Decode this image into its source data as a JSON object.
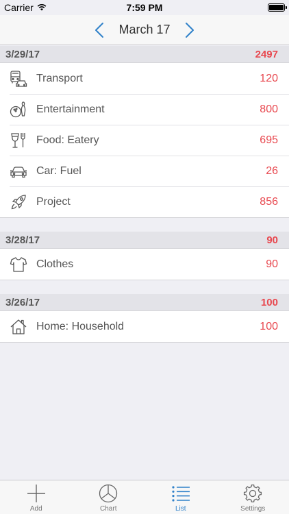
{
  "status_bar": {
    "carrier": "Carrier",
    "time": "7:59 PM"
  },
  "nav": {
    "title": "March 17"
  },
  "sections": [
    {
      "date": "3/29/17",
      "total": "2497",
      "items": [
        {
          "icon": "bus-car-icon",
          "label": "Transport",
          "amount": "120"
        },
        {
          "icon": "bowling-icon",
          "label": "Entertainment",
          "amount": "800"
        },
        {
          "icon": "glass-fork-icon",
          "label": "Food: Eatery",
          "amount": "695"
        },
        {
          "icon": "car-icon",
          "label": "Car: Fuel",
          "amount": "26"
        },
        {
          "icon": "rocket-icon",
          "label": "Project",
          "amount": "856"
        }
      ]
    },
    {
      "date": "3/28/17",
      "total": "90",
      "items": [
        {
          "icon": "shirt-icon",
          "label": "Clothes",
          "amount": "90"
        }
      ]
    },
    {
      "date": "3/26/17",
      "total": "100",
      "items": [
        {
          "icon": "house-icon",
          "label": "Home: Household",
          "amount": "100"
        }
      ]
    }
  ],
  "tabs": [
    {
      "icon": "plus-icon",
      "label": "Add",
      "active": false
    },
    {
      "icon": "pie-chart-icon",
      "label": "Chart",
      "active": false
    },
    {
      "icon": "list-icon",
      "label": "List",
      "active": true
    },
    {
      "icon": "gear-icon",
      "label": "Settings",
      "active": false
    }
  ],
  "colors": {
    "accent": "#2f80c9",
    "amount": "#e8484f"
  }
}
